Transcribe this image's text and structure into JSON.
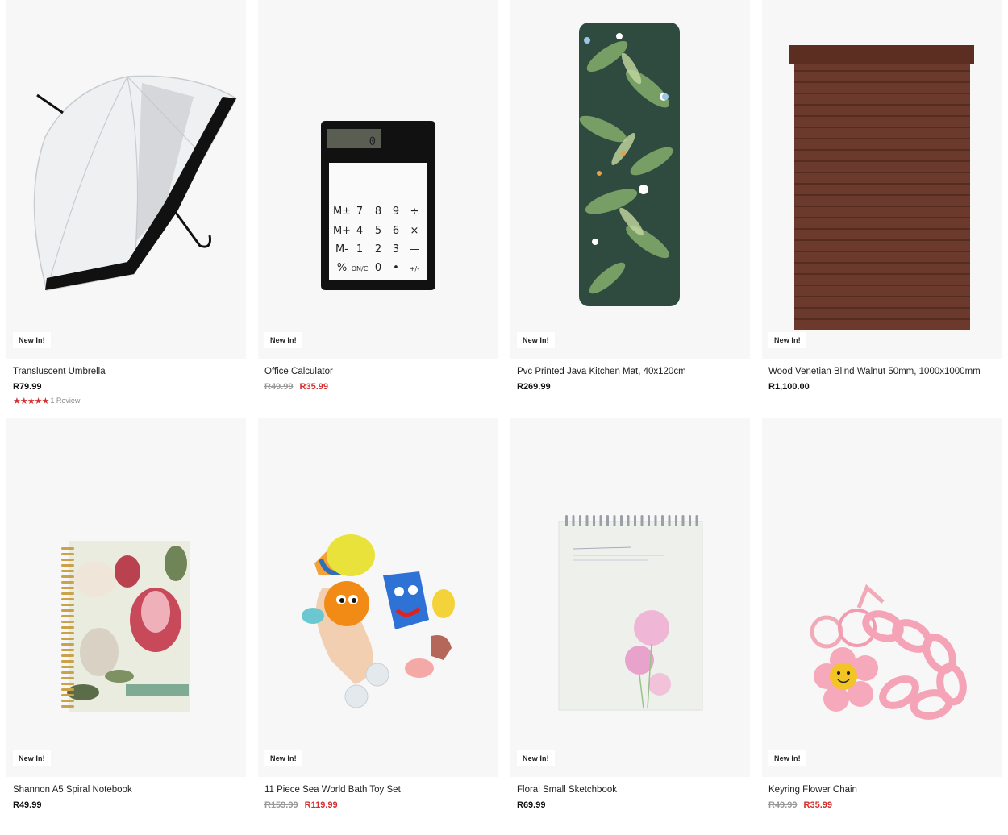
{
  "badge_label": "New In!",
  "products": [
    {
      "name": "Transluscent Umbrella",
      "price": "R79.99",
      "rating": {
        "stars": 5,
        "review_text": "1 Review"
      }
    },
    {
      "name": "Office Calculator",
      "was_price": "R49.99",
      "sale_price": "R35.99"
    },
    {
      "name": "Pvc Printed Java Kitchen Mat, 40x120cm",
      "price": "R269.99"
    },
    {
      "name": "Wood Venetian Blind Walnut 50mm, 1000x1000mm",
      "price": "R1,100.00"
    },
    {
      "name": "Shannon A5 Spiral Notebook",
      "price": "R49.99"
    },
    {
      "name": "11 Piece Sea World Bath Toy Set",
      "was_price": "R159.99",
      "sale_price": "R119.99"
    },
    {
      "name": "Floral Small Sketchbook",
      "price": "R69.99"
    },
    {
      "name": "Keyring Flower Chain",
      "was_price": "R49.99",
      "sale_price": "R35.99"
    }
  ],
  "calculator_keys": [
    "M±",
    "7",
    "8",
    "9",
    "÷",
    "M+",
    "4",
    "5",
    "6",
    "×",
    "M-",
    "1",
    "2",
    "3",
    "—",
    "%",
    "ON/C",
    "0",
    "•",
    "+/-"
  ],
  "calculator_display": "0",
  "colors": {
    "sale_red": "#d32f2f",
    "image_bg": "#f7f7f7"
  }
}
